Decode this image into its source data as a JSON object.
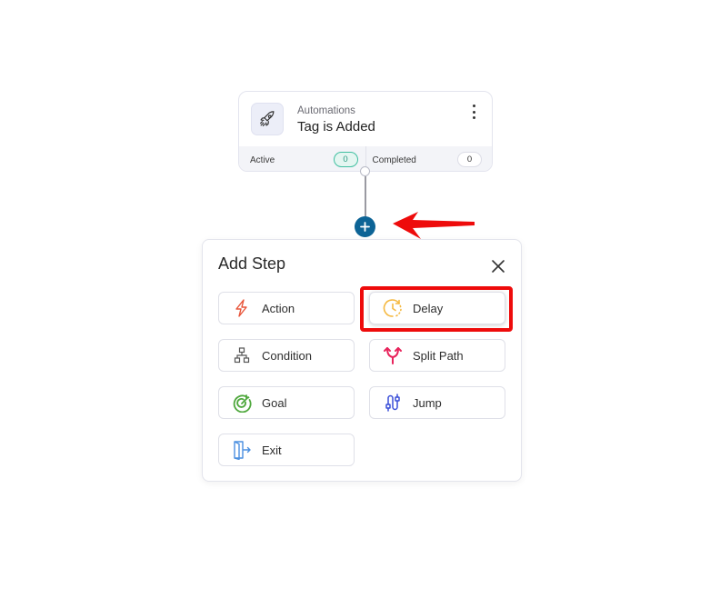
{
  "trigger": {
    "category": "Automations",
    "title": "Tag is Added",
    "icon": "rocket-icon",
    "stats": [
      {
        "label": "Active",
        "value": "0",
        "color": "#3fbfa0"
      },
      {
        "label": "Completed",
        "value": "0"
      }
    ]
  },
  "add_step_button": {
    "icon": "plus-icon",
    "color": "#0d6496"
  },
  "annotation": {
    "arrow_color": "#ee0b0b",
    "highlight_color": "#ee0b0b",
    "highlighted_step": "Delay"
  },
  "panel": {
    "title": "Add Step",
    "close_icon": "close-icon",
    "steps": [
      {
        "label": "Action",
        "icon": "lightning-icon",
        "color": "#e8553a"
      },
      {
        "label": "Delay",
        "icon": "clock-icon",
        "color": "#f5b942"
      },
      {
        "label": "Condition",
        "icon": "hierarchy-icon",
        "color": "#555555"
      },
      {
        "label": "Split Path",
        "icon": "split-arrows-icon",
        "color": "#e8245c"
      },
      {
        "label": "Goal",
        "icon": "target-icon",
        "color": "#4fa83d"
      },
      {
        "label": "Jump",
        "icon": "jump-icon",
        "color": "#3a4fd8"
      },
      {
        "label": "Exit",
        "icon": "exit-door-icon",
        "color": "#4a8fe0"
      }
    ]
  }
}
